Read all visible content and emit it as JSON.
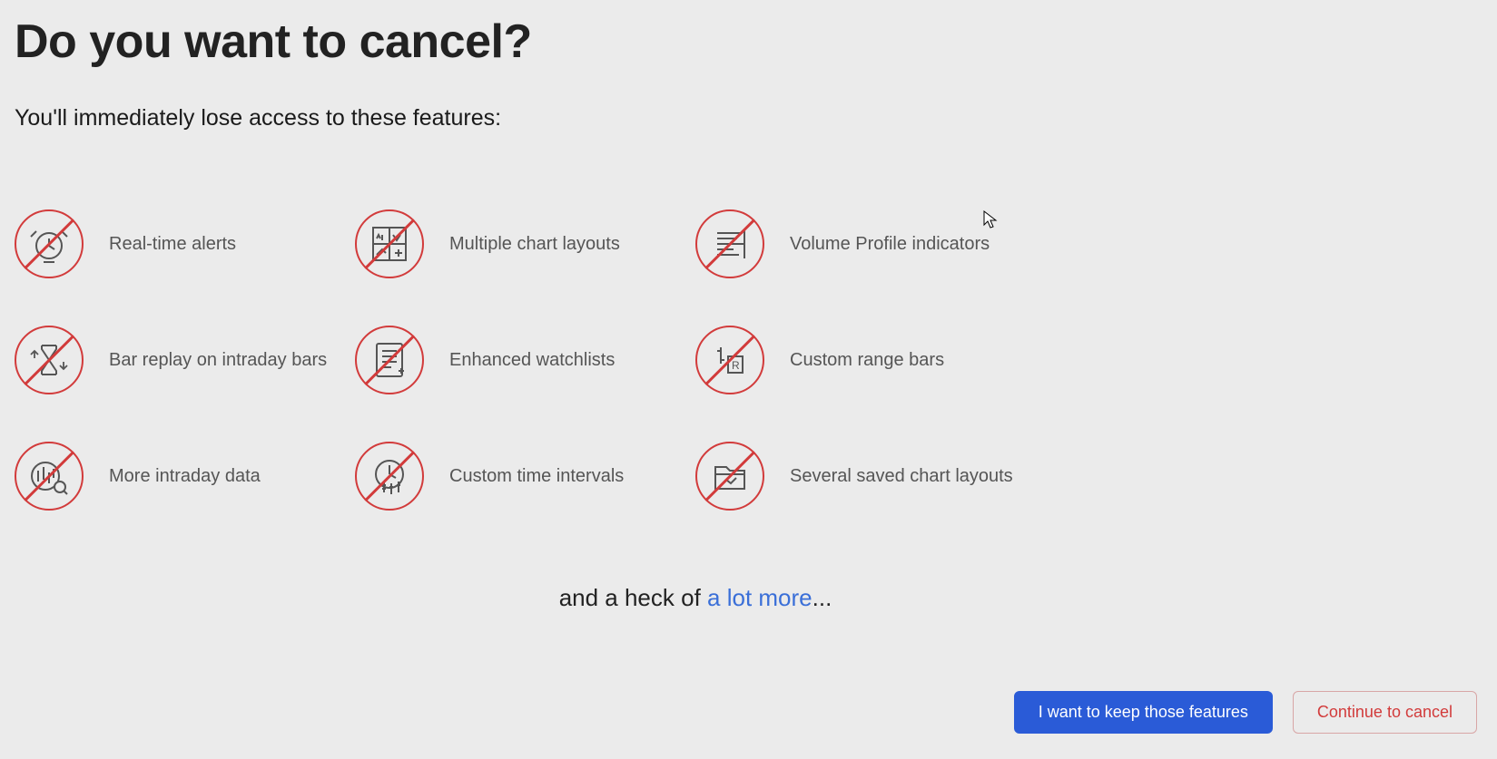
{
  "title": "Do you want to cancel?",
  "subtitle": "You'll immediately lose access to these features:",
  "features": [
    {
      "label": "Real-time alerts",
      "icon": "clock-alert-icon"
    },
    {
      "label": "Multiple chart layouts",
      "icon": "grid-chart-icon"
    },
    {
      "label": "Volume Profile indicators",
      "icon": "volume-profile-icon"
    },
    {
      "label": "Bar replay on intraday bars",
      "icon": "hourglass-icon"
    },
    {
      "label": "Enhanced watchlists",
      "icon": "list-icon"
    },
    {
      "label": "Custom range bars",
      "icon": "range-bars-icon"
    },
    {
      "label": "More intraday data",
      "icon": "intraday-icon"
    },
    {
      "label": "Custom time intervals",
      "icon": "time-interval-icon"
    },
    {
      "label": "Several saved chart layouts",
      "icon": "folder-chart-icon"
    }
  ],
  "footer": {
    "prefix": "and a heck of ",
    "link": "a lot more",
    "suffix": "..."
  },
  "buttons": {
    "keep": "I want to keep those features",
    "cancel": "Continue to cancel"
  },
  "colors": {
    "prohibition": "#d23b3b",
    "primary": "#2a5bd7",
    "link": "#3a6fd8"
  }
}
